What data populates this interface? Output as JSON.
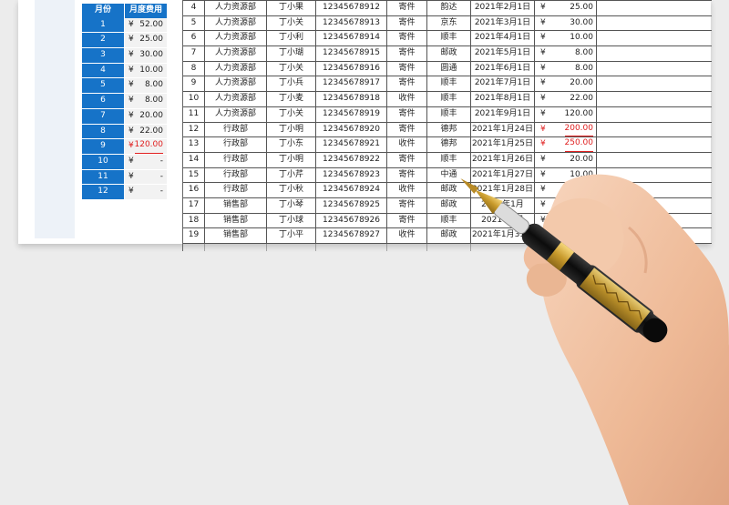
{
  "colors": {
    "accent": "#1673c8",
    "negative": "#e02020",
    "skin": "#f2c6a8"
  },
  "left_panel": {
    "header_month": "月份",
    "header_expense": "月度费用",
    "currency": "¥",
    "rows": [
      {
        "month": "1",
        "value": "52.00",
        "red": false
      },
      {
        "month": "2",
        "value": "25.00",
        "red": false
      },
      {
        "month": "3",
        "value": "30.00",
        "red": false
      },
      {
        "month": "4",
        "value": "10.00",
        "red": false
      },
      {
        "month": "5",
        "value": "8.00",
        "red": false
      },
      {
        "month": "6",
        "value": "8.00",
        "red": false
      },
      {
        "month": "7",
        "value": "20.00",
        "red": false
      },
      {
        "month": "8",
        "value": "22.00",
        "red": false
      },
      {
        "month": "9",
        "value": "120.00",
        "red": true
      },
      {
        "month": "10",
        "value": "-",
        "red": false
      },
      {
        "month": "11",
        "value": "-",
        "red": false
      },
      {
        "month": "12",
        "value": "-",
        "red": false
      }
    ]
  },
  "main_table": {
    "currency": "¥",
    "rows": [
      {
        "no": "4",
        "dept": "人力资源部",
        "name": "丁小果",
        "phone": "12345678912",
        "type": "寄件",
        "express": "韵达",
        "date": "2021年2月1日",
        "amount": "25.00",
        "red": false
      },
      {
        "no": "5",
        "dept": "人力资源部",
        "name": "丁小关",
        "phone": "12345678913",
        "type": "寄件",
        "express": "京东",
        "date": "2021年3月1日",
        "amount": "30.00",
        "red": false
      },
      {
        "no": "6",
        "dept": "人力资源部",
        "name": "丁小利",
        "phone": "12345678914",
        "type": "寄件",
        "express": "顺丰",
        "date": "2021年4月1日",
        "amount": "10.00",
        "red": false
      },
      {
        "no": "7",
        "dept": "人力资源部",
        "name": "丁小瑚",
        "phone": "12345678915",
        "type": "寄件",
        "express": "邮政",
        "date": "2021年5月1日",
        "amount": "8.00",
        "red": false
      },
      {
        "no": "8",
        "dept": "人力资源部",
        "name": "丁小关",
        "phone": "12345678916",
        "type": "寄件",
        "express": "圆通",
        "date": "2021年6月1日",
        "amount": "8.00",
        "red": false
      },
      {
        "no": "9",
        "dept": "人力资源部",
        "name": "丁小兵",
        "phone": "12345678917",
        "type": "寄件",
        "express": "顺丰",
        "date": "2021年7月1日",
        "amount": "20.00",
        "red": false
      },
      {
        "no": "10",
        "dept": "人力资源部",
        "name": "丁小麦",
        "phone": "12345678918",
        "type": "收件",
        "express": "顺丰",
        "date": "2021年8月1日",
        "amount": "22.00",
        "red": false
      },
      {
        "no": "11",
        "dept": "人力资源部",
        "name": "丁小关",
        "phone": "12345678919",
        "type": "寄件",
        "express": "顺丰",
        "date": "2021年9月1日",
        "amount": "120.00",
        "red": false
      },
      {
        "no": "12",
        "dept": "行政部",
        "name": "丁小明",
        "phone": "12345678920",
        "type": "寄件",
        "express": "德邦",
        "date": "2021年1月24日",
        "amount": "200.00",
        "red": true
      },
      {
        "no": "13",
        "dept": "行政部",
        "name": "丁小东",
        "phone": "12345678921",
        "type": "收件",
        "express": "德邦",
        "date": "2021年1月25日",
        "amount": "250.00",
        "red": true
      },
      {
        "no": "14",
        "dept": "行政部",
        "name": "丁小明",
        "phone": "12345678922",
        "type": "寄件",
        "express": "顺丰",
        "date": "2021年1月26日",
        "amount": "20.00",
        "red": false
      },
      {
        "no": "15",
        "dept": "行政部",
        "name": "丁小芹",
        "phone": "12345678923",
        "type": "寄件",
        "express": "中通",
        "date": "2021年1月27日",
        "amount": "10.00",
        "red": false
      },
      {
        "no": "16",
        "dept": "行政部",
        "name": "丁小秋",
        "phone": "12345678924",
        "type": "收件",
        "express": "邮政",
        "date": "2021年1月28日",
        "amount": "10.00",
        "red": false
      },
      {
        "no": "17",
        "dept": "销售部",
        "name": "丁小琴",
        "phone": "12345678925",
        "type": "寄件",
        "express": "邮政",
        "date": "2021年1月",
        "amount": "",
        "red": false
      },
      {
        "no": "18",
        "dept": "销售部",
        "name": "丁小球",
        "phone": "12345678926",
        "type": "寄件",
        "express": "顺丰",
        "date": "2021年1月",
        "amount": "",
        "red": false
      },
      {
        "no": "19",
        "dept": "销售部",
        "name": "丁小平",
        "phone": "12345678927",
        "type": "收件",
        "express": "邮政",
        "date": "2021年1月31日",
        "amount": "",
        "red": false
      }
    ]
  }
}
